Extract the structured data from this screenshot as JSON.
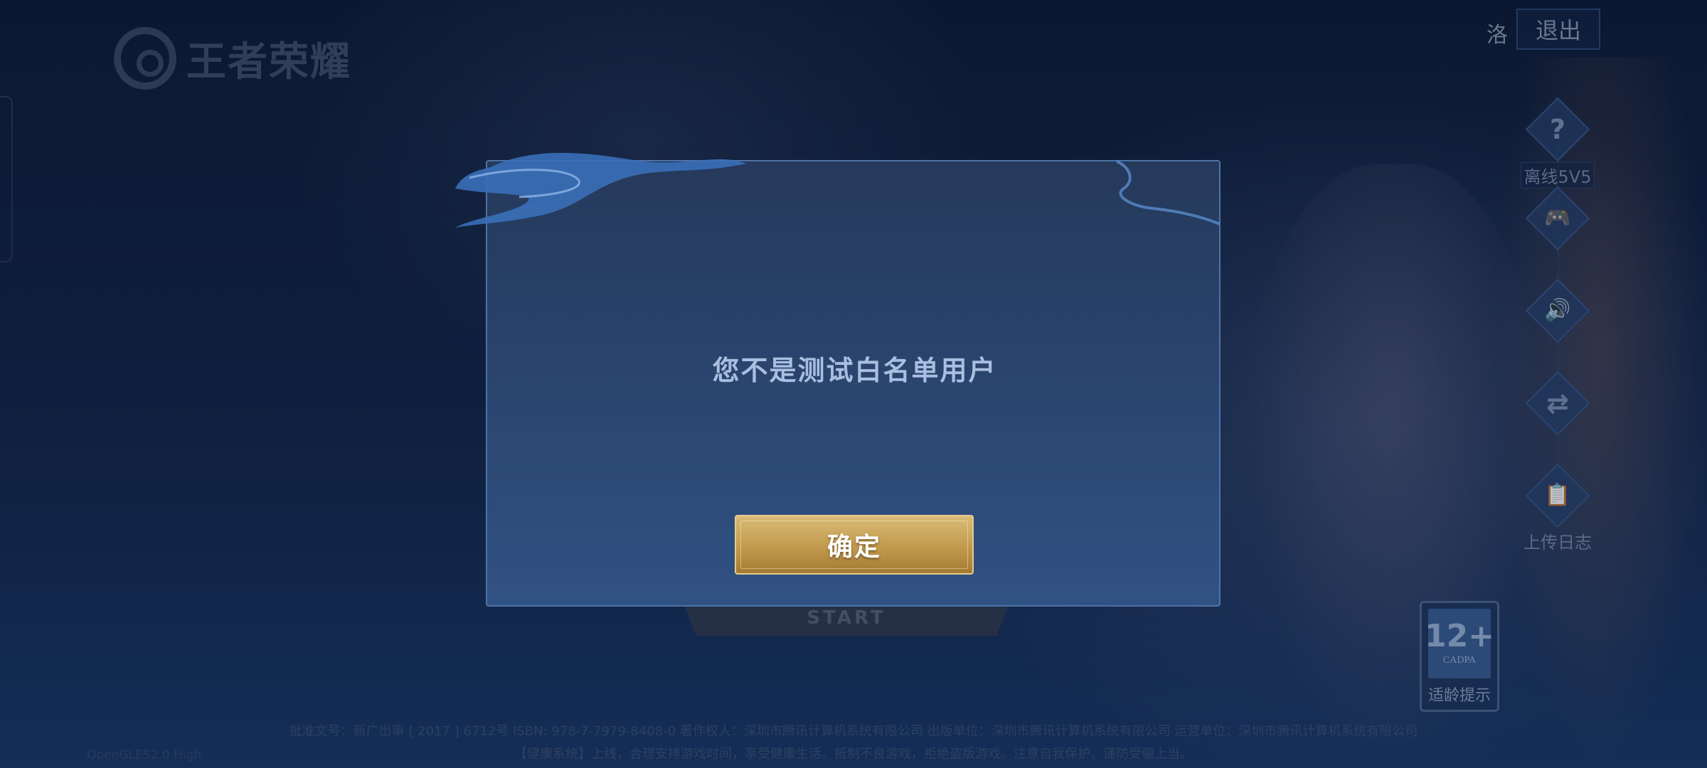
{
  "header": {
    "logo_text": "王者荣耀",
    "user_name": "洛",
    "logout_label": "退出"
  },
  "side_menu": {
    "items": [
      {
        "icon": "question-icon",
        "glyph": "?",
        "label": "离线5V5"
      },
      {
        "icon": "gamepad-icon",
        "glyph": "🎮",
        "label": ""
      },
      {
        "icon": "speaker-icon",
        "glyph": "🔊",
        "label": ""
      },
      {
        "icon": "switch-account-icon",
        "glyph": "⇄",
        "label": ""
      },
      {
        "icon": "clipboard-icon",
        "glyph": "📋",
        "label": "上传日志"
      }
    ]
  },
  "start_button": {
    "label": "START"
  },
  "age_rating": {
    "number": "12+",
    "org": "CADPA",
    "tip": "适龄提示"
  },
  "footer": {
    "line1": "批准文号：新广出审 [ 2017 ] 6712号  ISBN: 978-7-7979-8408-0  著作权人：深圳市腾讯计算机系统有限公司  出版单位：深圳市腾讯计算机系统有限公司  运营单位：深圳市腾讯计算机系统有限公司",
    "line2": "【健康系统】上线，合理安排游戏时间，享受健康生活。抵制不良游戏，拒绝盗版游戏。注意自我保护，谨防受骗上当。",
    "renderer": "OpenGLES2.0 High"
  },
  "dialog": {
    "message": "您不是测试白名单用户",
    "confirm_label": "确定"
  },
  "colors": {
    "dialog_bg": "#2b4670",
    "dialog_border": "#4d73a6",
    "confirm_gold": "#c29a4d",
    "message_text": "#a9bee0"
  }
}
